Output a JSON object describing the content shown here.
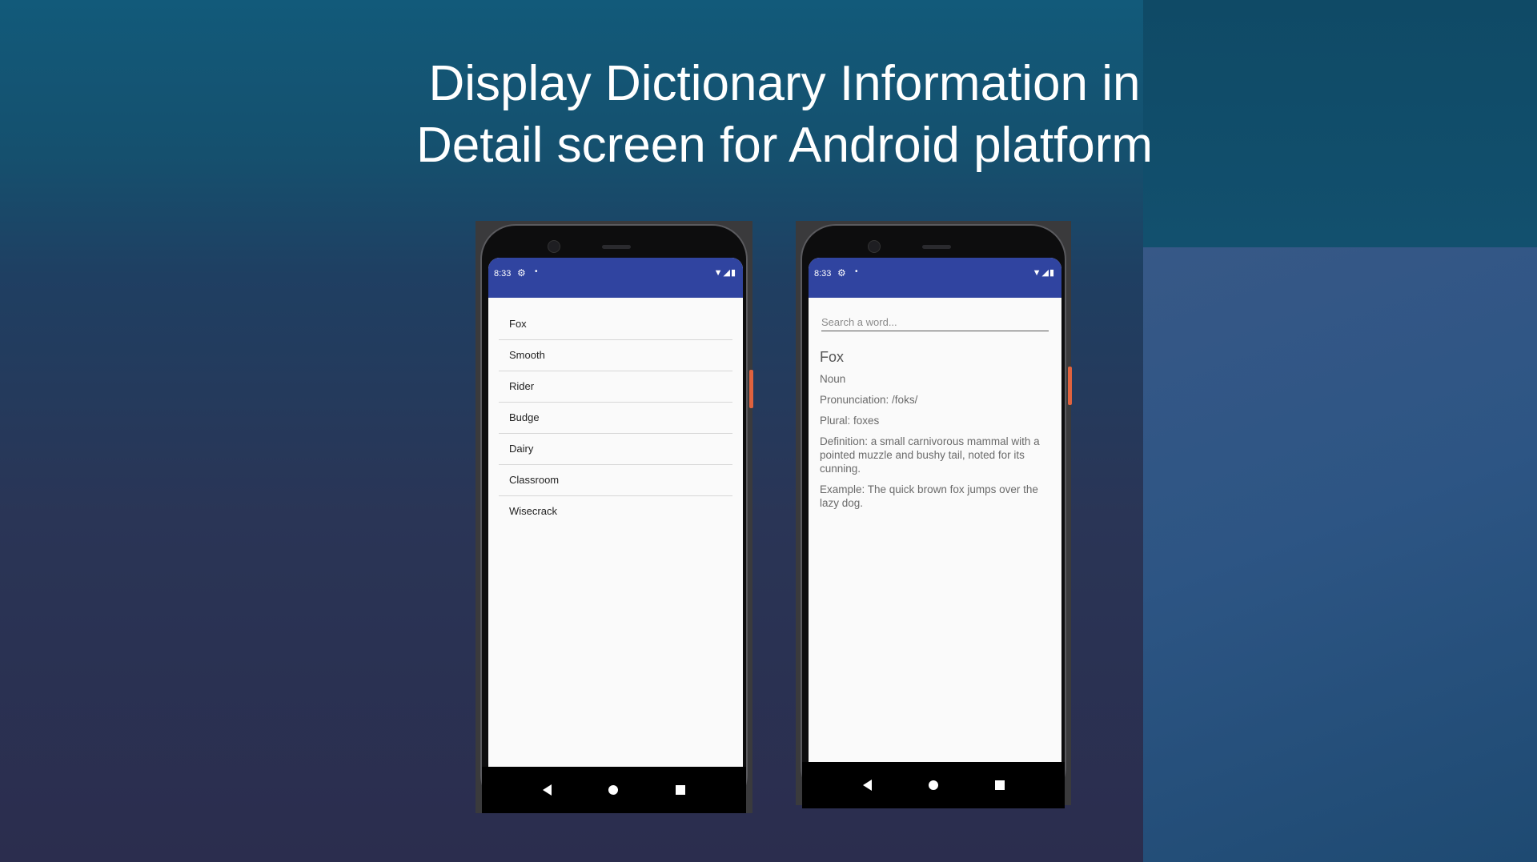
{
  "slide": {
    "title_line1": "Display Dictionary Information in",
    "title_line2": "Detail screen for Android platform"
  },
  "phone_left": {
    "status": {
      "time": "8:33",
      "gear_icon": "⚙",
      "dot": "•",
      "icons": "▼◢▮"
    },
    "words": [
      "Fox",
      "Smooth",
      "Rider",
      "Budge",
      "Dairy",
      "Classroom",
      "Wisecrack"
    ]
  },
  "phone_right": {
    "status": {
      "time": "8:33",
      "gear_icon": "⚙",
      "dot": "•",
      "icons": "▼◢▮"
    },
    "search_placeholder": "Search a word...",
    "detail": {
      "word": "Fox",
      "part_of_speech": "Noun",
      "pronunciation": "Pronunciation: /foks/",
      "plural": "Plural: foxes",
      "definition": "Definition: a small carnivorous mammal with a pointed muzzle and bushy tail, noted for its cunning.",
      "example": "Example: The quick brown fox jumps over the lazy dog."
    }
  },
  "colors": {
    "status_bar": "#3044a0",
    "accent_button": "#e0623e"
  }
}
